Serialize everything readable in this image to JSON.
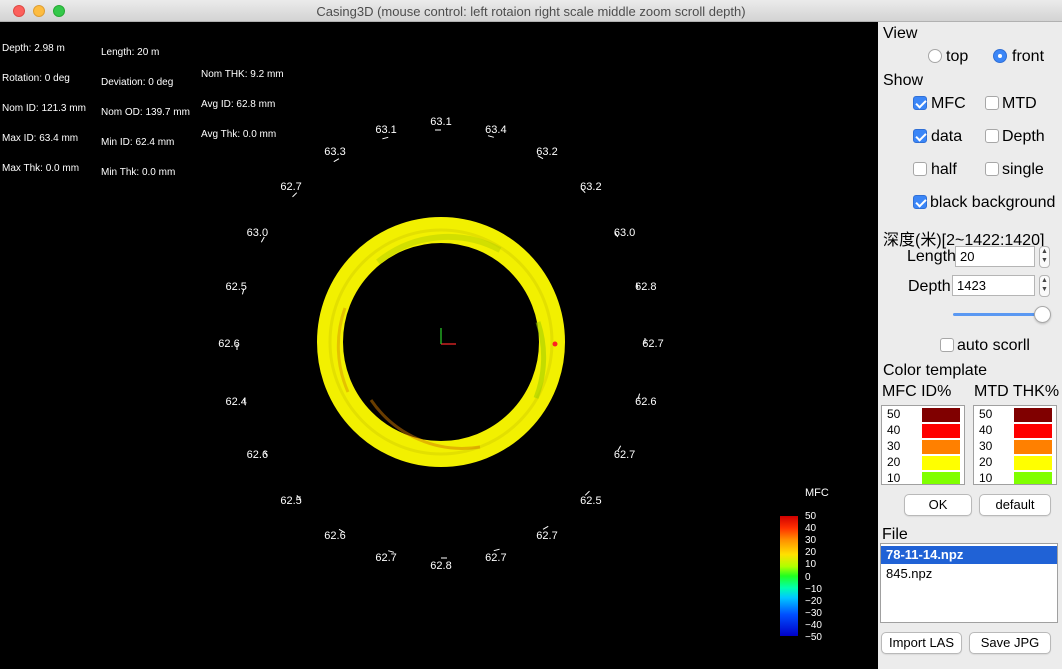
{
  "window": {
    "title": "Casing3D (mouse control: left rotaion right scale middle zoom scroll depth)"
  },
  "info": {
    "col1": [
      "Depth: 2.98 m",
      "Rotation: 0 deg",
      "Nom ID: 121.3 mm",
      "Max ID: 63.4 mm",
      "Max Thk: 0.0 mm"
    ],
    "col2": [
      "Length: 20 m",
      "Deviation: 0 deg",
      "Nom OD: 139.7 mm",
      "Min ID: 62.4 mm",
      "Min Thk: 0.0 mm"
    ],
    "col3": [
      "Nom THK: 9.2 mm",
      "Avg ID: 62.8 mm",
      "Avg Thk: 0.0 mm"
    ]
  },
  "ring_labels": [
    "63.1",
    "63.4",
    "63.2",
    "63.2",
    "63.0",
    "62.8",
    "62.7",
    "62.6",
    "62.7",
    "62.5",
    "62.7",
    "62.7",
    "62.8",
    "62.7",
    "62.6",
    "62.5",
    "62.6",
    "62.4",
    "62.6",
    "62.5",
    "63.0",
    "62.7",
    "63.3",
    "63.1"
  ],
  "colorbar": {
    "title": "MFC",
    "ticks": [
      "50",
      "40",
      "30",
      "20",
      "10",
      "0",
      "−10",
      "−20",
      "−30",
      "−40",
      "−50"
    ],
    "max": 50,
    "min": -50
  },
  "panel": {
    "view_label": "View",
    "view_options": [
      {
        "label": "top",
        "selected": false
      },
      {
        "label": "front",
        "selected": true
      }
    ],
    "show_label": "Show",
    "show_checks": [
      {
        "label": "MFC",
        "checked": true
      },
      {
        "label": "MTD",
        "checked": false
      },
      {
        "label": "data",
        "checked": true
      },
      {
        "label": "Depth",
        "checked": false
      },
      {
        "label": "half",
        "checked": false
      },
      {
        "label": "single",
        "checked": false
      }
    ],
    "black_background": {
      "label": "black background",
      "checked": true
    },
    "depth_range": "深度(米)[2~1422:1420]",
    "length": {
      "label": "Length",
      "value": "20"
    },
    "depth": {
      "label": "Depth",
      "value": "1423"
    },
    "depth_slider_level": 1.0,
    "auto_scroll": {
      "label": "auto scorll",
      "checked": false
    },
    "color_template_label": "Color template",
    "mfc_header": "MFC ID%",
    "mtd_header": "MTD THK%",
    "color_rows": [
      {
        "value": "50",
        "color": "#800000"
      },
      {
        "value": "40",
        "color": "#ff0000"
      },
      {
        "value": "30",
        "color": "#ff8000"
      },
      {
        "value": "20",
        "color": "#ffff00"
      },
      {
        "value": "10",
        "color": "#80ff00"
      }
    ],
    "ok_label": "OK",
    "default_label": "default",
    "file_label": "File",
    "files": [
      {
        "name": "78-11-14.npz",
        "selected": true
      },
      {
        "name": "845.npz",
        "selected": false
      }
    ],
    "import_label": "Import LAS",
    "save_label": "Save JPG"
  }
}
